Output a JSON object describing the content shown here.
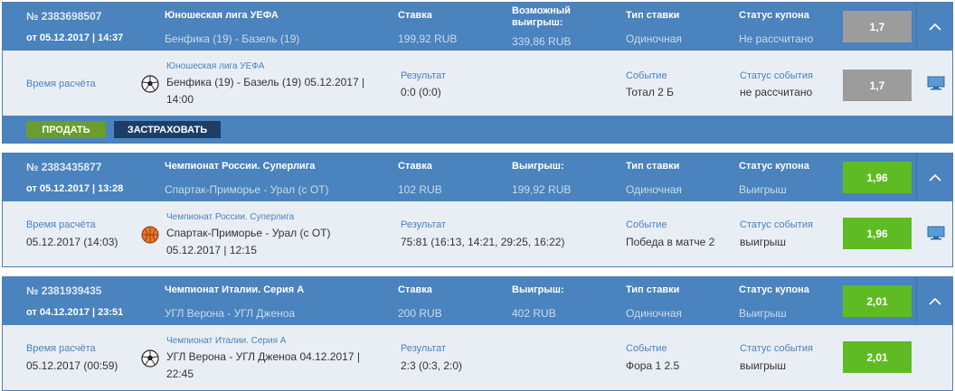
{
  "coupons": [
    {
      "number": "№ 2383698507",
      "date": "от 05.12.2017 | 14:37",
      "league": "Юношеская лига УЕФА",
      "match": "Бенфика (19) - Базель (19)",
      "stake_label": "Ставка",
      "stake": "199,92 RUB",
      "win_label_1": "Возможный",
      "win_label_2": "выигрыш:",
      "win": "339,86 RUB",
      "type_label": "Тип ставки",
      "type": "Одиночная",
      "status_label": "Статус купона",
      "status": "Не рассчитано",
      "odds": "1,7",
      "odds_color": "#9c9c9c",
      "detail": {
        "calc_label": "Время расчёта",
        "calc_value": "",
        "league": "Юношеская лига УЕФА",
        "event_line1": "Бенфика (19) - Базель (19) 05.12.2017 |",
        "event_line2": "14:00",
        "sport_icon": "soccer-ball-icon",
        "result_label": "Результат",
        "result": "0:0 (0:0)",
        "event_label": "Событие",
        "event": "Тотал 2 Б",
        "event_status_label": "Статус события",
        "event_status": "не рассчитано",
        "odds": "1,7"
      },
      "actions": {
        "sell": "ПРОДАТЬ",
        "insure": "ЗАСТРАХОВАТЬ"
      }
    },
    {
      "number": "№ 2383435877",
      "date": "от 05.12.2017 | 13:28",
      "league": "Чемпионат России. Суперлига",
      "match": "Спартак-Приморье - Урал (с ОТ)",
      "stake_label": "Ставка",
      "stake": "102 RUB",
      "win_label_1": "Выигрыш:",
      "win_label_2": "",
      "win": "199,92 RUB",
      "type_label": "Тип ставки",
      "type": "Одиночная",
      "status_label": "Статус купона",
      "status": "Выигрыш",
      "odds": "1,96",
      "odds_color": "#5fbb24",
      "detail": {
        "calc_label": "Время расчёта",
        "calc_value": "05.12.2017 (14:03)",
        "league": "Чемпионат России. Суперлига",
        "event_line1": "Спартак-Приморье - Урал (с ОТ)",
        "event_line2": "05.12.2017 | 12:15",
        "sport_icon": "basketball-icon",
        "result_label": "Результат",
        "result": "75:81 (16:13, 14:21, 29:25, 16:22)",
        "event_label": "Событие",
        "event": "Победа в матче 2",
        "event_status_label": "Статус события",
        "event_status": "выигрыш",
        "odds": "1,96"
      }
    },
    {
      "number": "№ 2381939435",
      "date": "от 04.12.2017 | 23:51",
      "league": "Чемпионат Италии. Серия А",
      "match": "УГЛ Верона - УГЛ Дженоа",
      "stake_label": "Ставка",
      "stake": "200 RUB",
      "win_label_1": "Выигрыш:",
      "win_label_2": "",
      "win": "402 RUB",
      "type_label": "Тип ставки",
      "type": "Одиночная",
      "status_label": "Статус купона",
      "status": "Выигрыш",
      "odds": "2,01",
      "odds_color": "#5fbb24",
      "detail": {
        "calc_label": "Время расчёта",
        "calc_value": "05.12.2017 (00:59)",
        "league": "Чемпионат Италии. Серия А",
        "event_line1": "УГЛ Верона - УГЛ Дженоа 04.12.2017 |",
        "event_line2": "22:45",
        "sport_icon": "soccer-ball-icon",
        "result_label": "Результат",
        "result": "2:3 (0:3, 2:0)",
        "event_label": "Событие",
        "event": "Фора 1 2.5",
        "event_status_label": "Статус события",
        "event_status": "выигрыш",
        "odds": "2,01"
      }
    }
  ]
}
